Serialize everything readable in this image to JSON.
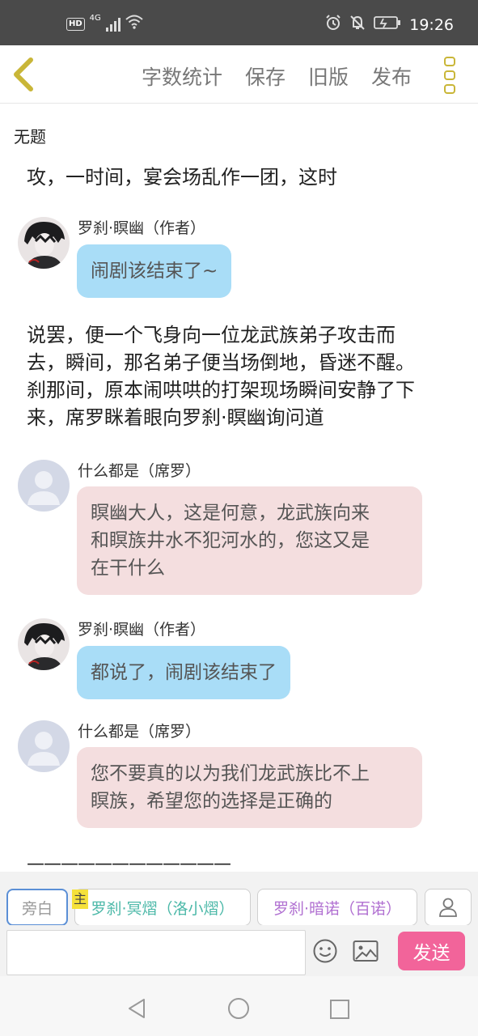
{
  "status_bar": {
    "network_badge": "HD",
    "network_type": "4G",
    "time": "19:26",
    "icons": [
      "hd-icon",
      "signal-icon",
      "wifi-icon",
      "alarm-icon",
      "mute-icon",
      "battery-icon"
    ]
  },
  "toolbar": {
    "back_icon": "chevron-left-icon",
    "word_count": "字数统计",
    "save": "保存",
    "old_version": "旧版",
    "publish": "发布",
    "more_icon": "more-vertical-icon",
    "accent_color": "#c9b638"
  },
  "document": {
    "title": "无题"
  },
  "content": {
    "narration_top": "攻，一时间，宴会场乱作一团，这时",
    "msg1": {
      "sender": "罗刹·瞑幽（作者）",
      "text": "闹剧该结束了~"
    },
    "narration_mid": [
      "说罢，便一个飞身向一位龙武族弟子攻击而",
      "去，瞬间，那名弟子便当场倒地，昏迷不醒。",
      "刹那间，原本闹哄哄的打架现场瞬间安静了下",
      "来，席罗眯着眼向罗刹·瞑幽询问道"
    ],
    "msg2": {
      "sender": "什么都是（席罗）",
      "lines": [
        "瞑幽大人，这是何意，龙武族向来",
        "和瞑族井水不犯河水的，您这又是",
        "在干什么"
      ]
    },
    "msg3": {
      "sender": "罗刹·瞑幽（作者）",
      "text": "都说了，闹剧该结束了"
    },
    "msg4": {
      "sender": "什么都是（席罗）",
      "lines": [
        "您不要真的以为我们龙武族比不上",
        "瞑族，希望您的选择是正确的"
      ]
    },
    "divider": "————————————"
  },
  "roles": {
    "narrator": "旁白",
    "main_tag": "主",
    "role1": "罗刹·冥熠（洛小熠）",
    "role2": "罗刹·暗诺（百诺）",
    "add_role_icon": "person-icon"
  },
  "input": {
    "value": "",
    "placeholder": "",
    "emoji_icon": "smiley-icon",
    "image_icon": "image-icon",
    "send": "发送",
    "send_color": "#f2649a"
  },
  "nav": {
    "icons": [
      "back-triangle-icon",
      "home-circle-icon",
      "recents-square-icon"
    ]
  }
}
